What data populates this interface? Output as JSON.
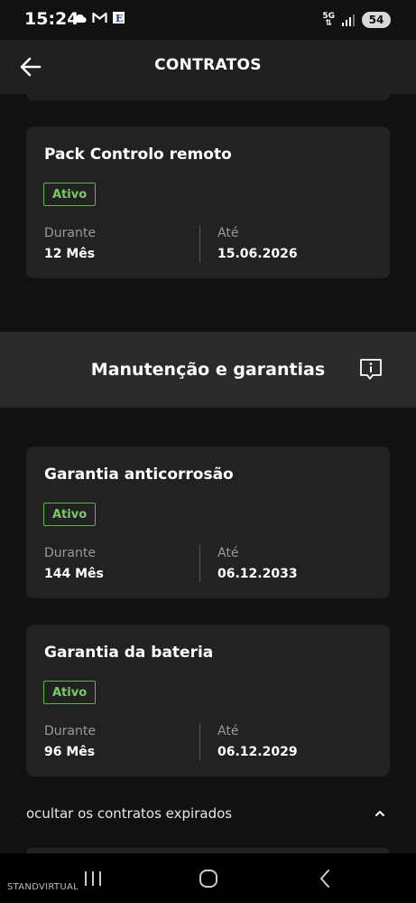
{
  "status_bar": {
    "time": "15:24",
    "network": "5G",
    "battery": "54",
    "icons": [
      "cloud-icon",
      "gmail-icon",
      "expresso-icon",
      "signal-icon"
    ]
  },
  "app_bar": {
    "title": "CONTRATOS",
    "back_icon": "arrow-left-icon"
  },
  "contracts": [
    {
      "title": "Pack Controlo remoto",
      "status": "Ativo",
      "duration_label": "Durante",
      "duration_value": "12 Mês",
      "until_label": "Até",
      "until_value": "15.06.2026"
    }
  ],
  "section": {
    "title": "Manutenção e garantias",
    "info_icon": "info-icon"
  },
  "warranties": [
    {
      "title": "Garantia anticorrosão",
      "status": "Ativo",
      "duration_label": "Durante",
      "duration_value": "144 Mês",
      "until_label": "Até",
      "until_value": "06.12.2033"
    },
    {
      "title": "Garantia da bateria",
      "status": "Ativo",
      "duration_label": "Durante",
      "duration_value": "96 Mês",
      "until_label": "Até",
      "until_value": "06.12.2029"
    }
  ],
  "toggle": {
    "label": "ocultar os contratos expirados",
    "icon": "chevron-up-icon"
  },
  "watermark": "STANDVIRTUAL",
  "colors": {
    "background": "#111111",
    "card": "#222222",
    "badge": "#7cc96a"
  }
}
